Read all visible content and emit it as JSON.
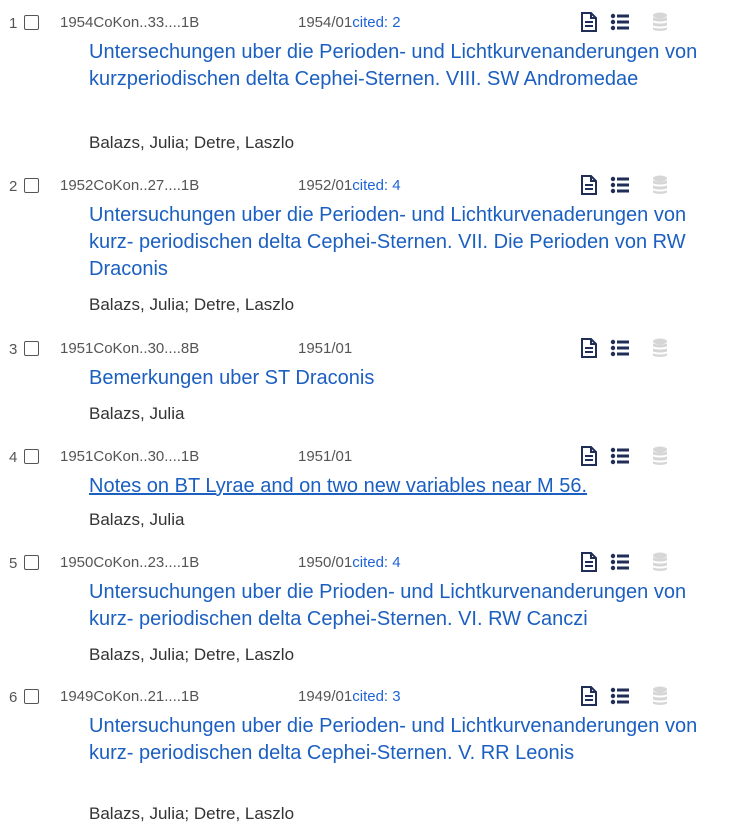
{
  "results": [
    {
      "num": "1",
      "bibcode": "1954CoKon..33....1B",
      "date": "1954/01",
      "cited": "cited: 2",
      "title": "Untersechungen uber die Perioden- und Lichtkurvenanderungen von kurzperiodischen delta Cephei-Sternen. VIII. SW Andromedae",
      "authors": "Balazs, Julia;  Detre, Laszlo"
    },
    {
      "num": "2",
      "bibcode": "1952CoKon..27....1B",
      "date": "1952/01",
      "cited": "cited: 4",
      "title": "Untersuchungen uber die Perioden- und Lichtkurvenaderungen von kurz- periodischen delta Cephei-Sternen. VII. Die Perioden von RW Draconis",
      "authors": "Balazs, Julia;  Detre, Laszlo"
    },
    {
      "num": "3",
      "bibcode": "1951CoKon..30....8B",
      "date": "1951/01",
      "cited": "",
      "title": "Bemerkungen uber ST Draconis",
      "authors": "Balazs, Julia"
    },
    {
      "num": "4",
      "bibcode": "1951CoKon..30....1B",
      "date": "1951/01",
      "cited": "",
      "title": "Notes on BT Lyrae and on two new variables near M 56.",
      "authors": "Balazs, Julia"
    },
    {
      "num": "5",
      "bibcode": "1950CoKon..23....1B",
      "date": "1950/01",
      "cited": "cited: 4",
      "title": "Untersuchungen uber die Prioden- und Lichtkurvenanderungen von kurz- periodischen delta Cephei-Sternen. VI. RW Canczi",
      "authors": "Balazs, Julia;  Detre, Laszlo"
    },
    {
      "num": "6",
      "bibcode": "1949CoKon..21....1B",
      "date": "1949/01",
      "cited": "cited: 3",
      "title": "Untersuchungen uber die Perioden- und Lichtkurvenanderungen von kurz- periodischen delta Cephei-Sternen. V. RR Leonis",
      "authors": "Balazs, Julia;  Detre, Laszlo"
    }
  ],
  "icons": [
    "document-icon",
    "list-icon",
    "database-icon"
  ],
  "colors": {
    "link": "#1b5fc1",
    "cited": "#1d63d6",
    "icon": "#1f2d57",
    "disabled_icon": "#d6d6d6"
  }
}
